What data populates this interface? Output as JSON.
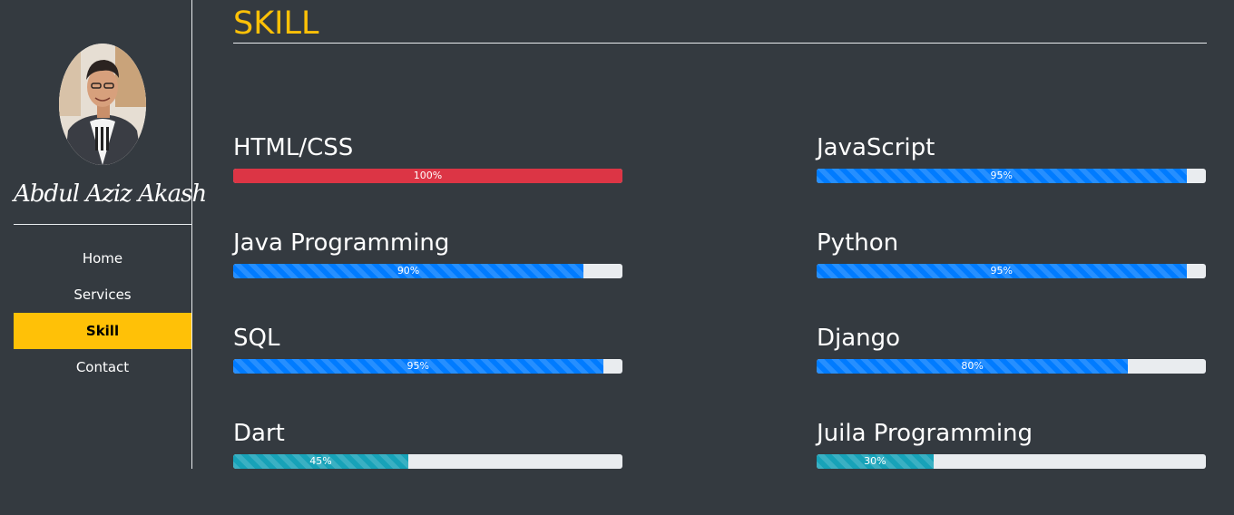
{
  "sidebar": {
    "name": "Abdul Aziz Akash",
    "nav": [
      {
        "label": "Home",
        "active": false
      },
      {
        "label": "Services",
        "active": false
      },
      {
        "label": "Skill",
        "active": true
      },
      {
        "label": "Contact",
        "active": false
      }
    ]
  },
  "main": {
    "title": "SKILL",
    "skills": [
      {
        "name": "HTML/CSS",
        "percent": 100,
        "label": "100%",
        "color": "#dc3545",
        "striped": false
      },
      {
        "name": "JavaScript",
        "percent": 95,
        "label": "95%",
        "color": "#007bff",
        "striped": true
      },
      {
        "name": "Java Programming",
        "percent": 90,
        "label": "90%",
        "color": "#007bff",
        "striped": true
      },
      {
        "name": "Python",
        "percent": 95,
        "label": "95%",
        "color": "#007bff",
        "striped": true
      },
      {
        "name": "SQL",
        "percent": 95,
        "label": "95%",
        "color": "#007bff",
        "striped": true
      },
      {
        "name": "Django",
        "percent": 80,
        "label": "80%",
        "color": "#007bff",
        "striped": true
      },
      {
        "name": "Dart",
        "percent": 45,
        "label": "45%",
        "color": "#17a2b8",
        "striped": true
      },
      {
        "name": "Juila Programming",
        "percent": 30,
        "label": "30%",
        "color": "#17a2b8",
        "striped": true
      }
    ]
  },
  "colors": {
    "background": "#343a40",
    "accent": "#ffc107",
    "track": "#e9ecef"
  }
}
